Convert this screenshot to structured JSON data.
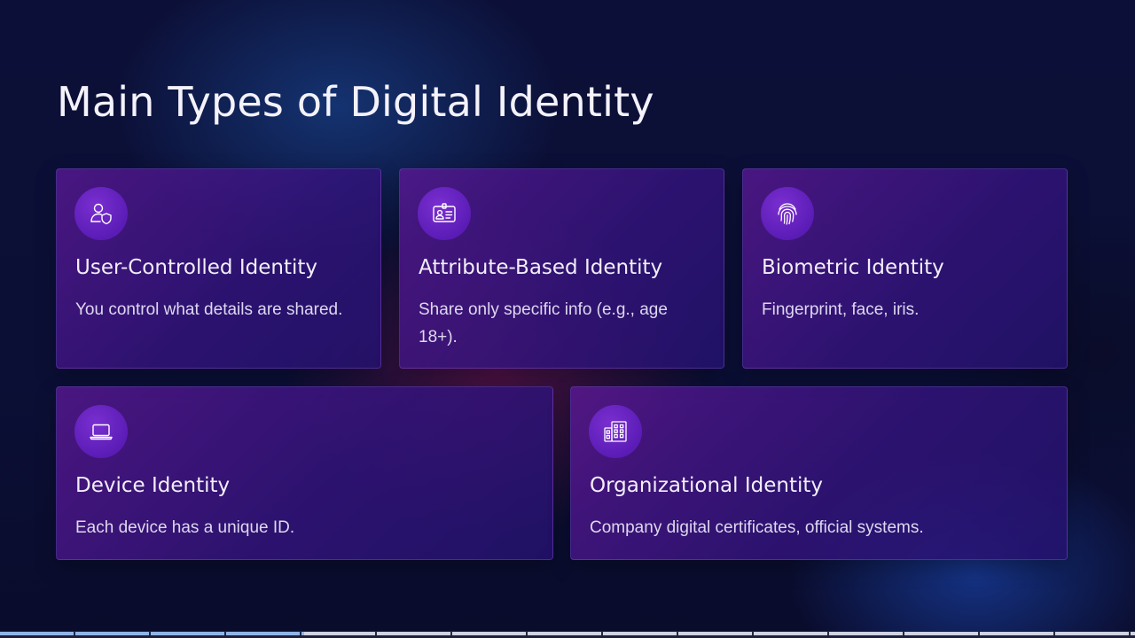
{
  "slide": {
    "title": "Main Types of Digital Identity"
  },
  "cards": [
    {
      "icon": "user-shield-icon",
      "title": "User-Controlled Identity",
      "description": "You control what details are shared."
    },
    {
      "icon": "id-badge-icon",
      "title": "Attribute-Based Identity",
      "description": "Share only specific info (e.g., age 18+)."
    },
    {
      "icon": "fingerprint-icon",
      "title": "Biometric Identity",
      "description": "Fingerprint, face, iris."
    },
    {
      "icon": "laptop-icon",
      "title": "Device Identity",
      "description": "Each device has a unique ID."
    },
    {
      "icon": "building-icon",
      "title": "Organizational Identity",
      "description": "Company digital certificates, official systems."
    }
  ],
  "video": {
    "progress_fraction": 0.268
  },
  "colors": {
    "background": "#0c0f35",
    "card": "#4a1a9a",
    "icon_badge": "#5b1cb6",
    "progress_played": "#8fb5e8",
    "progress_buffered": "#cfd3e2"
  }
}
